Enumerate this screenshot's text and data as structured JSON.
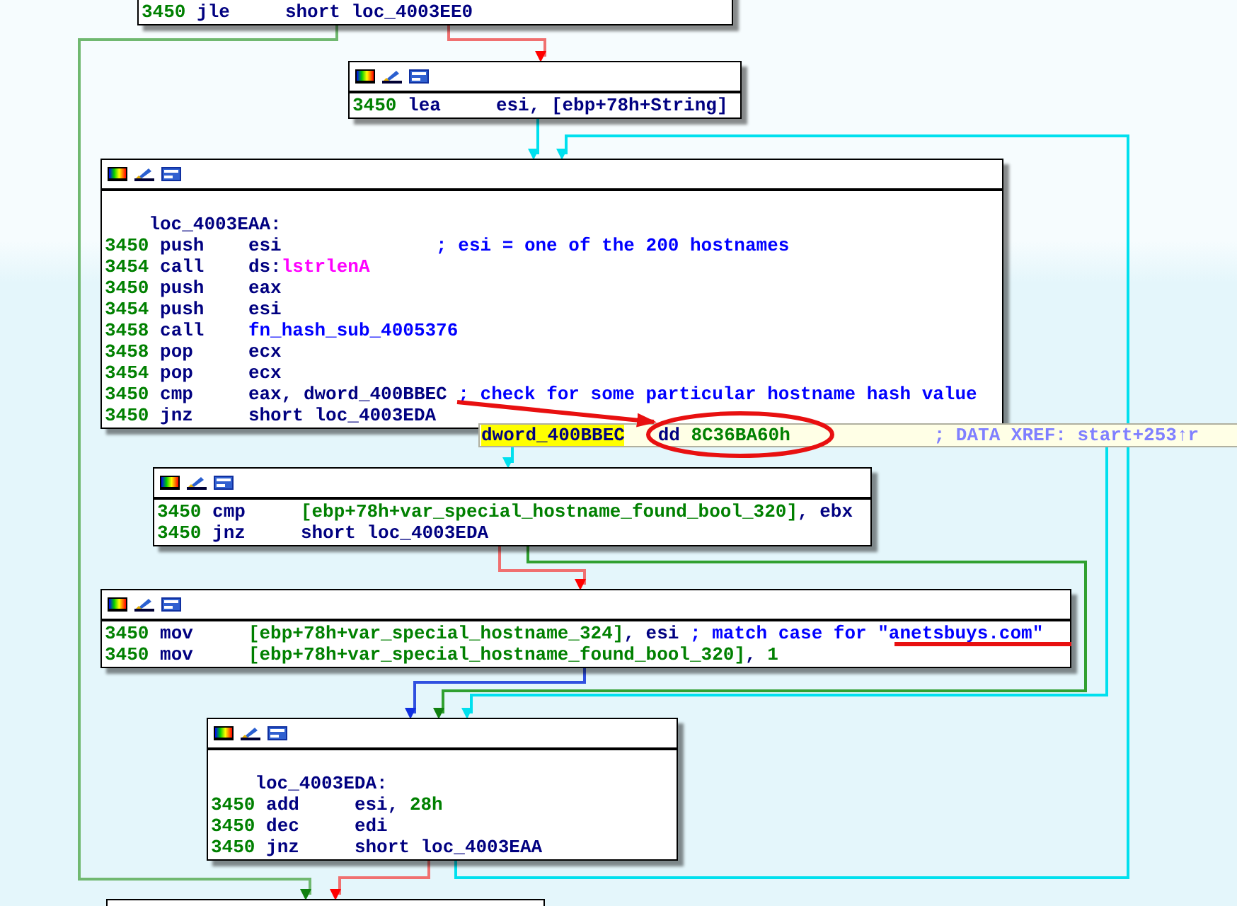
{
  "nodes": [
    {
      "lines": [
        {
          "kind": "insn",
          "addr": "3450",
          "mnemonic": "jle",
          "operands": [
            {
              "kind": "plain",
              "text": "short loc_4003EE0"
            }
          ]
        }
      ]
    },
    {
      "lines": [
        {
          "kind": "insn",
          "addr": "3450",
          "mnemonic": "lea",
          "operands": [
            {
              "kind": "plain",
              "text": "esi, [ebp+78h+String]"
            }
          ]
        }
      ]
    },
    {
      "lines": [
        {
          "kind": "label",
          "text": "loc_4003EAA:"
        },
        {
          "kind": "insn",
          "addr": "3450",
          "mnemonic": "push",
          "operands": [
            {
              "kind": "plain",
              "text": "esi"
            }
          ],
          "comment": "; esi = one of the 200 hostnames"
        },
        {
          "kind": "insn",
          "addr": "3454",
          "mnemonic": "call",
          "operands": [
            {
              "kind": "plain",
              "text": "ds:"
            },
            {
              "kind": "import",
              "text": "lstrlenA"
            }
          ]
        },
        {
          "kind": "insn",
          "addr": "3450",
          "mnemonic": "push",
          "operands": [
            {
              "kind": "plain",
              "text": "eax"
            }
          ]
        },
        {
          "kind": "insn",
          "addr": "3454",
          "mnemonic": "push",
          "operands": [
            {
              "kind": "plain",
              "text": "esi"
            }
          ]
        },
        {
          "kind": "insn",
          "addr": "3458",
          "mnemonic": "call",
          "operands": [
            {
              "kind": "func",
              "text": "fn_hash_sub_4005376"
            }
          ]
        },
        {
          "kind": "insn",
          "addr": "3458",
          "mnemonic": "pop",
          "operands": [
            {
              "kind": "plain",
              "text": "ecx"
            }
          ]
        },
        {
          "kind": "insn",
          "addr": "3454",
          "mnemonic": "pop",
          "operands": [
            {
              "kind": "plain",
              "text": "ecx"
            }
          ]
        },
        {
          "kind": "insn",
          "addr": "3450",
          "mnemonic": "cmp",
          "operands": [
            {
              "kind": "plain",
              "text": "eax, dword_400BBEC"
            }
          ],
          "comment": "; check for some particular hostname hash value"
        },
        {
          "kind": "insn",
          "addr": "3450",
          "mnemonic": "jnz",
          "operands": [
            {
              "kind": "plain",
              "text": "short loc_4003EDA"
            }
          ]
        }
      ]
    },
    {
      "lines": [
        {
          "kind": "insn",
          "addr": "3450",
          "mnemonic": "cmp",
          "operands": [
            {
              "kind": "stackvar",
              "text": "[ebp+78h+var_special_hostname_found_bool_320]"
            },
            {
              "kind": "plain",
              "text": ", ebx"
            }
          ]
        },
        {
          "kind": "insn",
          "addr": "3450",
          "mnemonic": "jnz",
          "operands": [
            {
              "kind": "plain",
              "text": "short loc_4003EDA"
            }
          ]
        }
      ]
    },
    {
      "lines": [
        {
          "kind": "insn",
          "addr": "3450",
          "mnemonic": "mov",
          "operands": [
            {
              "kind": "stackvar",
              "text": "[ebp+78h+var_special_hostname_324]"
            },
            {
              "kind": "plain",
              "text": ", esi"
            }
          ],
          "comment": "; match case for \"anetsbuys.com\""
        },
        {
          "kind": "insn",
          "addr": "3450",
          "mnemonic": "mov",
          "operands": [
            {
              "kind": "stackvar",
              "text": "[ebp+78h+var_special_hostname_found_bool_320]"
            },
            {
              "kind": "plain",
              "text": ", "
            },
            {
              "kind": "num",
              "text": "1"
            }
          ]
        }
      ]
    },
    {
      "lines": [
        {
          "kind": "label",
          "text": "loc_4003EDA:"
        },
        {
          "kind": "insn",
          "addr": "3450",
          "mnemonic": "add",
          "operands": [
            {
              "kind": "plain",
              "text": "esi, "
            },
            {
              "kind": "num",
              "text": "28h"
            }
          ]
        },
        {
          "kind": "insn",
          "addr": "3450",
          "mnemonic": "dec",
          "operands": [
            {
              "kind": "plain",
              "text": "edi"
            }
          ]
        },
        {
          "kind": "insn",
          "addr": "3450",
          "mnemonic": "jnz",
          "operands": [
            {
              "kind": "plain",
              "text": "short loc_4003EAA"
            }
          ]
        }
      ]
    }
  ],
  "data_tooltip": {
    "name": "dword_400BBEC",
    "directive": "dd",
    "value": "8C36BA60h",
    "comment": "; DATA XREF: start+253↑r"
  }
}
